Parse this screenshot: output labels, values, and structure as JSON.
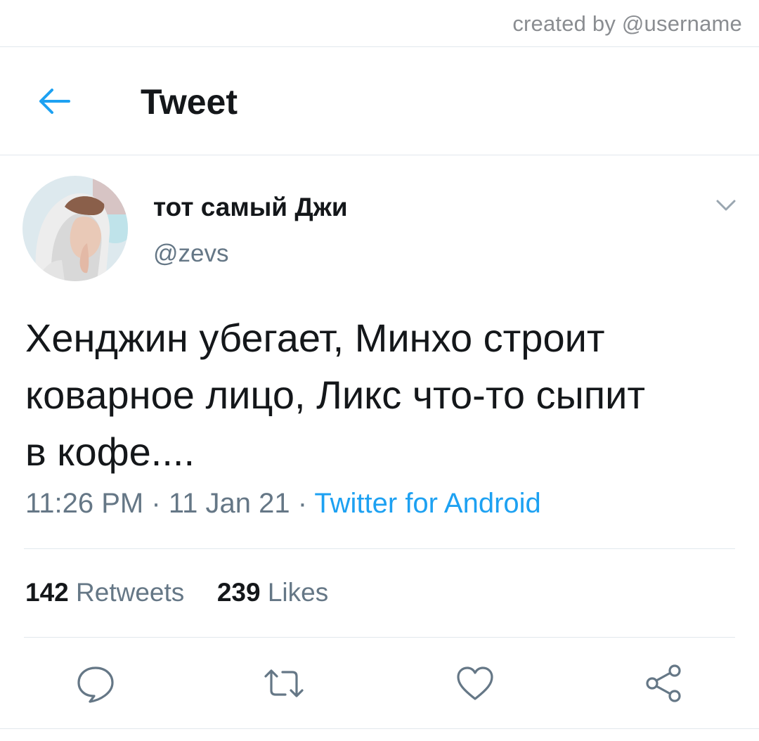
{
  "watermark": "created by @username",
  "header": {
    "title": "Tweet"
  },
  "tweet": {
    "display_name": "тот самый Джи",
    "handle": "@zevs",
    "text": "Хенджин убегает, Минхо строит\nковарное лицо, Ликс что-то сыпит\nв кофе....",
    "time": "11:26 PM",
    "date": "11 Jan 21",
    "separator": "·",
    "source": "Twitter for Android",
    "retweets_count": "142",
    "retweets_label": "Retweets",
    "likes_count": "239",
    "likes_label": "Likes"
  },
  "icons": {
    "back": "arrow-left-icon",
    "caret": "chevron-down-icon",
    "reply": "reply-icon",
    "retweet": "retweet-icon",
    "like": "heart-icon",
    "share": "share-icon"
  },
  "colors": {
    "accent": "#1da1f2",
    "text_primary": "#14171a",
    "text_secondary": "#657786",
    "divider": "#e1e8ed"
  }
}
